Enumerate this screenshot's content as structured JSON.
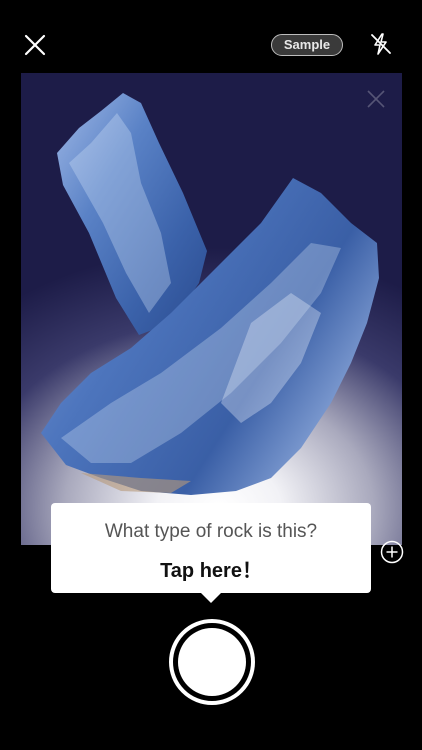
{
  "topbar": {
    "close_icon": "close-icon",
    "sample_label": "Sample",
    "flash_icon": "flash-off-icon"
  },
  "viewfinder": {
    "subject": "blue-crystal-photo",
    "faint_close_icon": "close-icon",
    "add_icon": "plus-circle-icon"
  },
  "tooltip": {
    "question": "What type of rock is this?",
    "action": "Tap here！"
  },
  "shutter": {
    "icon": "shutter-button"
  },
  "colors": {
    "background": "#000000",
    "crystal_blue": "#4a72b8",
    "tooltip_bg": "#ffffff"
  }
}
